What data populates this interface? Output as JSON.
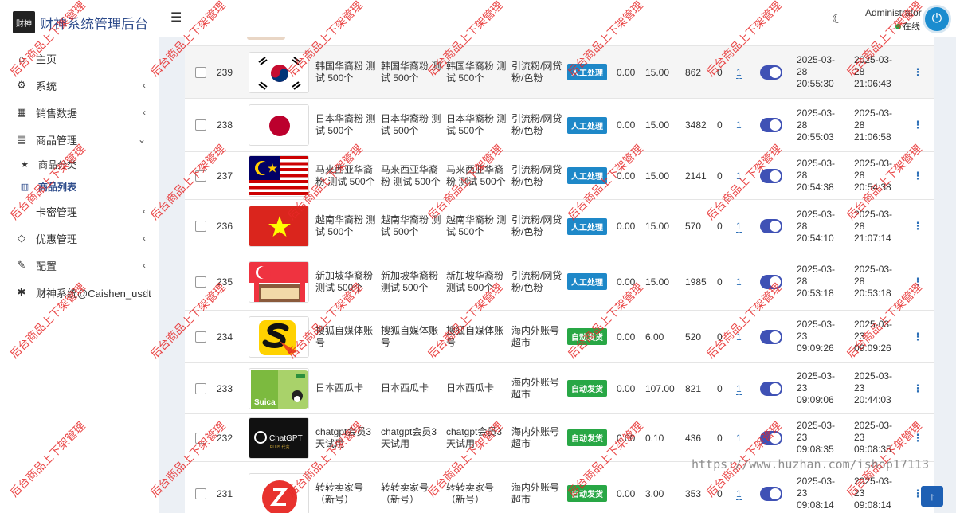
{
  "app": {
    "title": "财神系统管理后台",
    "logo_text": "财神"
  },
  "sidebar": {
    "items": [
      {
        "label": "主页",
        "icon": "home-icon",
        "glyph": "⌂"
      },
      {
        "label": "系统",
        "icon": "gear-icon",
        "glyph": "⚙"
      },
      {
        "label": "销售数据",
        "icon": "table-icon",
        "glyph": "▦"
      },
      {
        "label": "商品管理",
        "icon": "shopping-bag-icon",
        "glyph": "▤"
      },
      {
        "label": "商品分类",
        "icon": "star-icon",
        "glyph": "★"
      },
      {
        "label": "商品列表",
        "icon": "list-icon",
        "glyph": "▥"
      },
      {
        "label": "卡密管理",
        "icon": "credit-card-icon",
        "glyph": "▭"
      },
      {
        "label": "优惠管理",
        "icon": "diamond-icon",
        "glyph": "◇"
      },
      {
        "label": "配置",
        "icon": "wrench-icon",
        "glyph": "✎"
      },
      {
        "label": "财神系统@Caishen_usdt",
        "icon": "cog-icon",
        "glyph": "✱"
      }
    ]
  },
  "header": {
    "user_name": "Administrator",
    "user_status": "在线"
  },
  "rows": [
    {
      "id": "239",
      "flag": "korea",
      "t1": "韩国华裔粉 测试 500个",
      "t2": "韩国华裔粉 测试 500个",
      "t3": "韩国华裔粉 测试 500个",
      "cat": "引流粉/网贷粉/色粉",
      "badge": "人工处理",
      "badge_color": "blue",
      "p1": "0.00",
      "p2": "15.00",
      "stock": "862",
      "zero": "0",
      "link": "1",
      "d1": [
        "2025-03-",
        "28",
        "20:55:30"
      ],
      "d2": [
        "2025-03-",
        "28",
        "21:06:43"
      ]
    },
    {
      "id": "238",
      "flag": "japan",
      "t1": "日本华裔粉 测试 500个",
      "t2": "日本华裔粉 测试 500个",
      "t3": "日本华裔粉 测试 500个",
      "cat": "引流粉/网贷粉/色粉",
      "badge": "人工处理",
      "badge_color": "blue",
      "p1": "0.00",
      "p2": "15.00",
      "stock": "3482",
      "zero": "0",
      "link": "1",
      "d1": [
        "2025-03-",
        "28",
        "20:55:03"
      ],
      "d2": [
        "2025-03-",
        "28",
        "21:06:58"
      ]
    },
    {
      "id": "237",
      "flag": "malaysia",
      "t1": "马来西亚华裔粉 测试 500个",
      "t2": "马来西亚华裔粉 测试 500个",
      "t3": "马来西亚华裔粉 测试 500个",
      "cat": "引流粉/网贷粉/色粉",
      "badge": "人工处理",
      "badge_color": "blue",
      "p1": "0.00",
      "p2": "15.00",
      "stock": "2141",
      "zero": "0",
      "link": "1",
      "d1": [
        "2025-03-",
        "28",
        "20:54:38"
      ],
      "d2": [
        "2025-03-",
        "28",
        "20:54:38"
      ]
    },
    {
      "id": "236",
      "flag": "vietnam",
      "t1": "越南华裔粉 测试 500个",
      "t2": "越南华裔粉 测试 500个",
      "t3": "越南华裔粉 测试 500个",
      "cat": "引流粉/网贷粉/色粉",
      "badge": "人工处理",
      "badge_color": "blue",
      "p1": "0.00",
      "p2": "15.00",
      "stock": "570",
      "zero": "0",
      "link": "1",
      "d1": [
        "2025-03-",
        "28",
        "20:54:10"
      ],
      "d2": [
        "2025-03-",
        "28",
        "21:07:14"
      ]
    },
    {
      "id": "235",
      "flag": "singapore",
      "t1": "新加坡华裔粉 测试 500个",
      "t2": "新加坡华裔粉 测试 500个",
      "t3": "新加坡华裔粉 测试 500个",
      "cat": "引流粉/网贷粉/色粉",
      "badge": "人工处理",
      "badge_color": "blue",
      "p1": "0.00",
      "p2": "15.00",
      "stock": "1985",
      "zero": "0",
      "link": "1",
      "d1": [
        "2025-03-",
        "28",
        "20:53:18"
      ],
      "d2": [
        "2025-03-",
        "28",
        "20:53:18"
      ]
    },
    {
      "id": "234",
      "flag": "sohu",
      "t1": "搜狐自媒体账号",
      "t2": "搜狐自媒体账号",
      "t3": "搜狐自媒体账号",
      "cat": "海内外账号超市",
      "badge": "自动发货",
      "badge_color": "green",
      "p1": "0.00",
      "p2": "6.00",
      "stock": "520",
      "zero": "0",
      "link": "1",
      "d1": [
        "2025-03-",
        "23",
        "09:09:26"
      ],
      "d2": [
        "2025-03-",
        "23",
        "09:09:26"
      ]
    },
    {
      "id": "233",
      "flag": "suica",
      "t1": "日本西瓜卡",
      "t2": "日本西瓜卡",
      "t3": "日本西瓜卡",
      "cat": "海内外账号超市",
      "badge": "自动发货",
      "badge_color": "green",
      "p1": "0.00",
      "p2": "107.00",
      "stock": "821",
      "zero": "0",
      "link": "1",
      "d1": [
        "2025-03-",
        "23",
        "09:09:06"
      ],
      "d2": [
        "2025-03-",
        "23",
        "20:44:03"
      ]
    },
    {
      "id": "232",
      "flag": "chatgpt",
      "t1": "chatgpt会员3天试用",
      "t2": "chatgpt会员3天试用",
      "t3": "chatgpt会员3天试用",
      "cat": "海内外账号超市",
      "badge": "自动发货",
      "badge_color": "green",
      "p1": "0.00",
      "p2": "0.10",
      "stock": "436",
      "zero": "0",
      "link": "1",
      "d1": [
        "2025-03-",
        "23",
        "09:08:35"
      ],
      "d2": [
        "2025-03-",
        "23",
        "09:08:35"
      ]
    },
    {
      "id": "231",
      "flag": "zhuanzhuan",
      "t1": "转转卖家号（新号）",
      "t2": "转转卖家号（新号）",
      "t3": "转转卖家号（新号）",
      "cat": "海内外账号超市",
      "badge": "自动发货",
      "badge_color": "green",
      "p1": "0.00",
      "p2": "3.00",
      "stock": "353",
      "zero": "0",
      "link": "1",
      "d1": [
        "2025-03-",
        "23",
        "09:08:14"
      ],
      "d2": [
        "2025-03-",
        "23",
        "09:08:14"
      ]
    }
  ],
  "thumb_text": {
    "chatgpt": "ChatGPT",
    "chatgpt_sub": "PLUS 代充",
    "suica": "Suica"
  },
  "watermark": {
    "text": "后台商品上下架管理",
    "url": "https://www.huzhan.com/ishop17113"
  },
  "colors": {
    "primary": "#2c4a8a",
    "manual_badge": "#1e88c8",
    "auto_badge": "#28a745",
    "switch_on": "#3f51b5"
  }
}
